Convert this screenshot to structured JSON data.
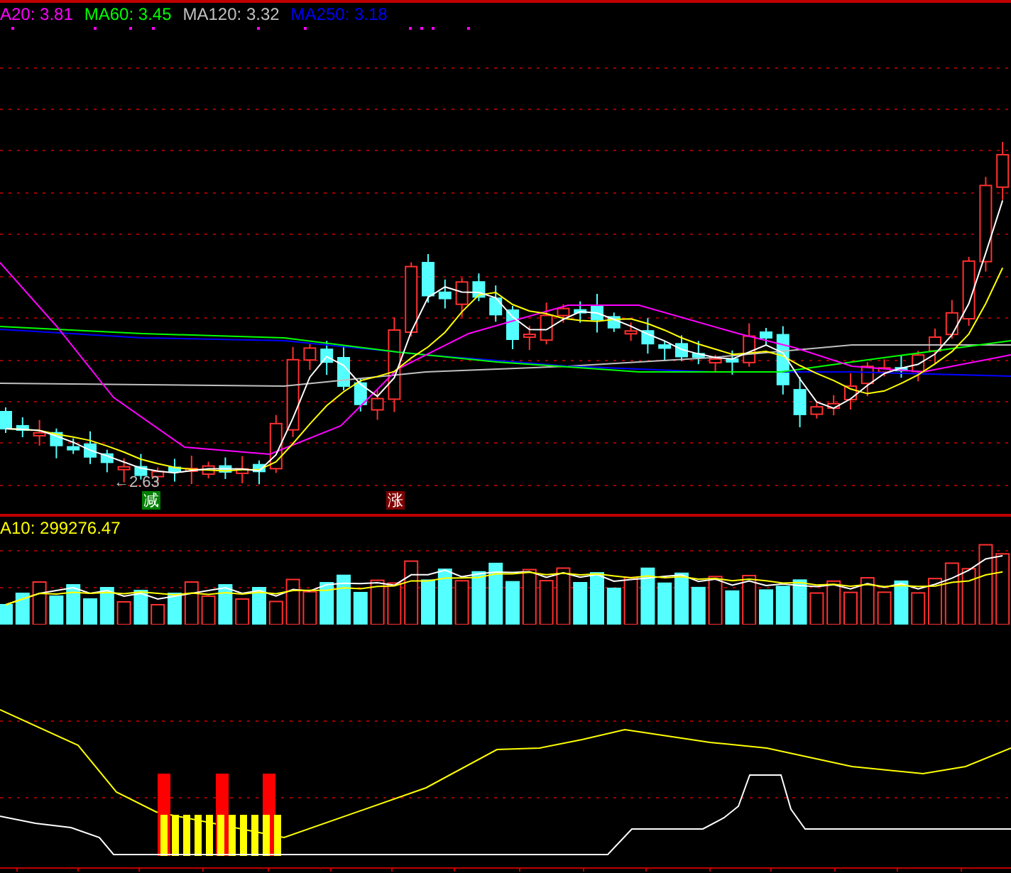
{
  "price_panel": {
    "legend": [
      {
        "label": "A20: 3.81",
        "color": "#ff00ff"
      },
      {
        "label": "MA60: 3.45",
        "color": "#00ff00"
      },
      {
        "label": "MA120: 3.32",
        "color": "#c0c0c0"
      },
      {
        "label": "MA250: 3.18",
        "color": "#0000ff"
      }
    ],
    "low_marker": "←2.63",
    "badges": [
      {
        "text": "减",
        "kind": "down"
      },
      {
        "text": "涨",
        "kind": "up"
      }
    ]
  },
  "volume_panel": {
    "legend": [
      {
        "label": "A10: 299276.47",
        "color": "#ffff00"
      }
    ]
  }
}
